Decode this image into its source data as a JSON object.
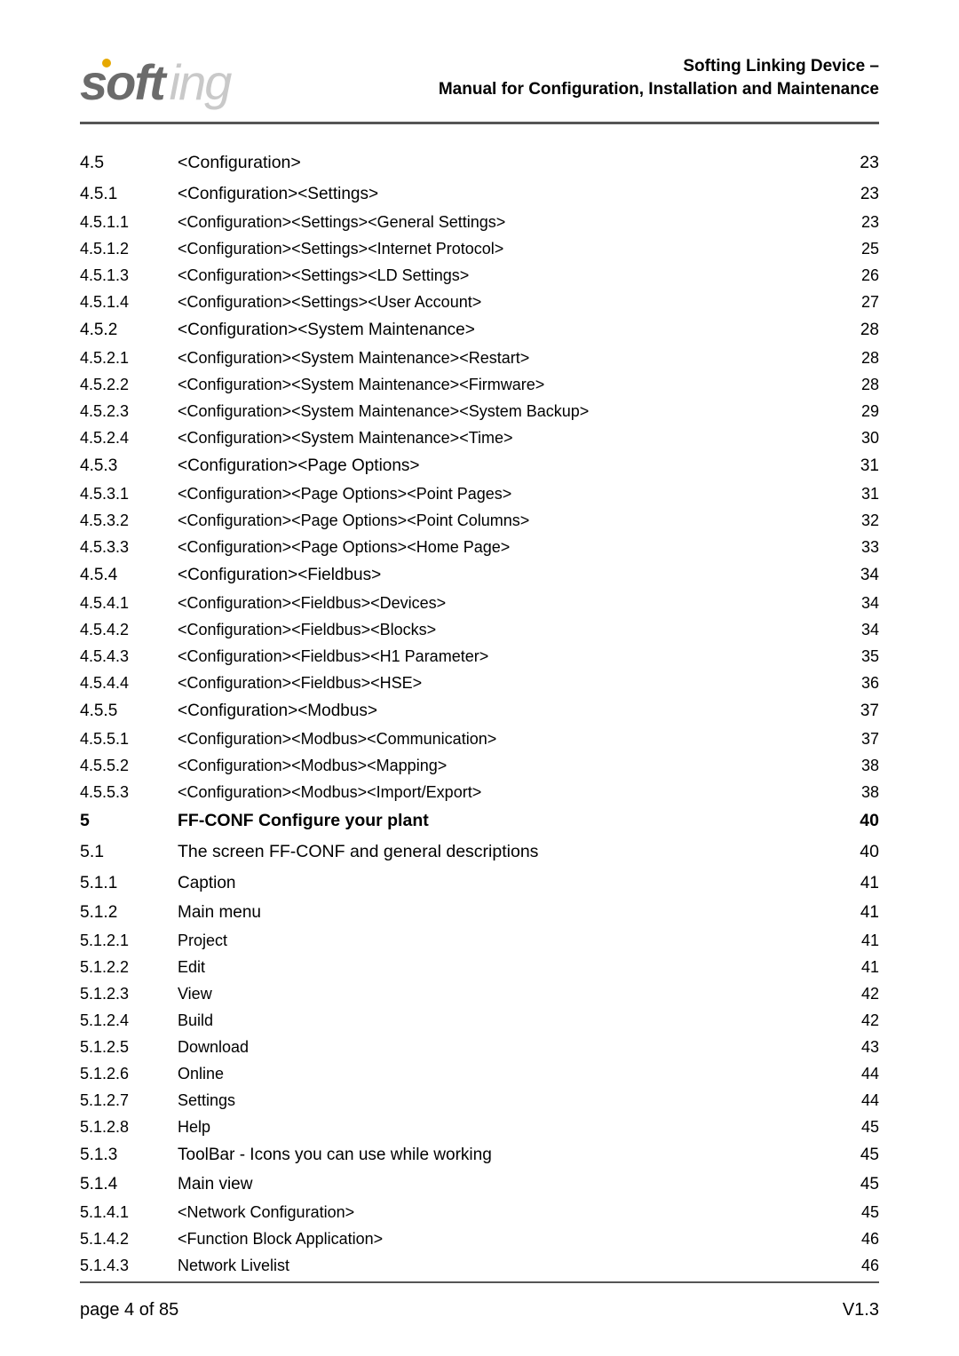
{
  "header": {
    "title_line1": "Softing Linking Device –",
    "title_line2": "Manual for Configuration, Installation and Maintenance",
    "logo_main": "soft",
    "logo_tail": "ing"
  },
  "toc": [
    {
      "num": "4.5",
      "title": "<Configuration>",
      "page": "23",
      "level": 2
    },
    {
      "num": "4.5.1",
      "title": "<Configuration><Settings>",
      "page": "23",
      "level": 3
    },
    {
      "num": "4.5.1.1",
      "title": "<Configuration><Settings><General Settings>",
      "page": "23",
      "level": 4
    },
    {
      "num": "4.5.1.2",
      "title": "<Configuration><Settings><Internet Protocol>",
      "page": "25",
      "level": 4
    },
    {
      "num": "4.5.1.3",
      "title": "<Configuration><Settings><LD Settings>",
      "page": "26",
      "level": 4
    },
    {
      "num": "4.5.1.4",
      "title": "<Configuration><Settings><User Account>",
      "page": "27",
      "level": 4
    },
    {
      "num": "4.5.2",
      "title": "<Configuration><System Maintenance>",
      "page": "28",
      "level": 3
    },
    {
      "num": "4.5.2.1",
      "title": "<Configuration><System Maintenance><Restart>",
      "page": "28",
      "level": 4
    },
    {
      "num": "4.5.2.2",
      "title": "<Configuration><System Maintenance><Firmware>",
      "page": "28",
      "level": 4
    },
    {
      "num": "4.5.2.3",
      "title": "<Configuration><System Maintenance><System Backup>",
      "page": "29",
      "level": 4
    },
    {
      "num": "4.5.2.4",
      "title": "<Configuration><System Maintenance><Time>",
      "page": "30",
      "level": 4
    },
    {
      "num": "4.5.3",
      "title": "<Configuration><Page Options>",
      "page": "31",
      "level": 3
    },
    {
      "num": "4.5.3.1",
      "title": "<Configuration><Page Options><Point Pages>",
      "page": "31",
      "level": 4
    },
    {
      "num": "4.5.3.2",
      "title": "<Configuration><Page Options><Point Columns>",
      "page": "32",
      "level": 4
    },
    {
      "num": "4.5.3.3",
      "title": "<Configuration><Page Options><Home Page>",
      "page": "33",
      "level": 4
    },
    {
      "num": "4.5.4",
      "title": "<Configuration><Fieldbus>",
      "page": "34",
      "level": 3
    },
    {
      "num": "4.5.4.1",
      "title": "<Configuration><Fieldbus><Devices>",
      "page": "34",
      "level": 4
    },
    {
      "num": "4.5.4.2",
      "title": "<Configuration><Fieldbus><Blocks>",
      "page": "34",
      "level": 4
    },
    {
      "num": "4.5.4.3",
      "title": "<Configuration><Fieldbus><H1 Parameter>",
      "page": "35",
      "level": 4
    },
    {
      "num": "4.5.4.4",
      "title": "<Configuration><Fieldbus><HSE>",
      "page": "36",
      "level": 4
    },
    {
      "num": "4.5.5",
      "title": "<Configuration><Modbus>",
      "page": "37",
      "level": 3
    },
    {
      "num": "4.5.5.1",
      "title": "<Configuration><Modbus><Communication>",
      "page": "37",
      "level": 4
    },
    {
      "num": "4.5.5.2",
      "title": "<Configuration><Modbus><Mapping>",
      "page": "38",
      "level": 4
    },
    {
      "num": "4.5.5.3",
      "title": "<Configuration><Modbus><Import/Export>",
      "page": "38",
      "level": 4
    },
    {
      "num": "5",
      "title": "FF-CONF Configure your plant",
      "page": "40",
      "level": 1,
      "bold": true
    },
    {
      "num": "5.1",
      "title": "The screen FF-CONF and general descriptions",
      "page": "40",
      "level": 2
    },
    {
      "num": "5.1.1",
      "title": "Caption",
      "page": "41",
      "level": 3
    },
    {
      "num": "5.1.2",
      "title": "Main menu",
      "page": "41",
      "level": 3
    },
    {
      "num": "5.1.2.1",
      "title": "Project",
      "page": "41",
      "level": 4
    },
    {
      "num": "5.1.2.2",
      "title": "Edit",
      "page": "41",
      "level": 4
    },
    {
      "num": "5.1.2.3",
      "title": "View",
      "page": "42",
      "level": 4
    },
    {
      "num": "5.1.2.4",
      "title": "Build",
      "page": "42",
      "level": 4
    },
    {
      "num": "5.1.2.5",
      "title": "Download",
      "page": "43",
      "level": 4
    },
    {
      "num": "5.1.2.6",
      "title": "Online",
      "page": "44",
      "level": 4
    },
    {
      "num": "5.1.2.7",
      "title": "Settings",
      "page": "44",
      "level": 4
    },
    {
      "num": "5.1.2.8",
      "title": "Help",
      "page": "45",
      "level": 4
    },
    {
      "num": "5.1.3",
      "title": "ToolBar - Icons you can use while working",
      "page": "45",
      "level": 3
    },
    {
      "num": "5.1.4",
      "title": "Main view",
      "page": "45",
      "level": 3
    },
    {
      "num": "5.1.4.1",
      "title": "<Network Configuration>",
      "page": "45",
      "level": 4
    },
    {
      "num": "5.1.4.2",
      "title": "<Function Block Application>",
      "page": "46",
      "level": 4
    },
    {
      "num": "5.1.4.3",
      "title": "Network Livelist",
      "page": "46",
      "level": 4
    }
  ],
  "footer": {
    "left": "page 4 of 85",
    "right": "V1.3"
  }
}
